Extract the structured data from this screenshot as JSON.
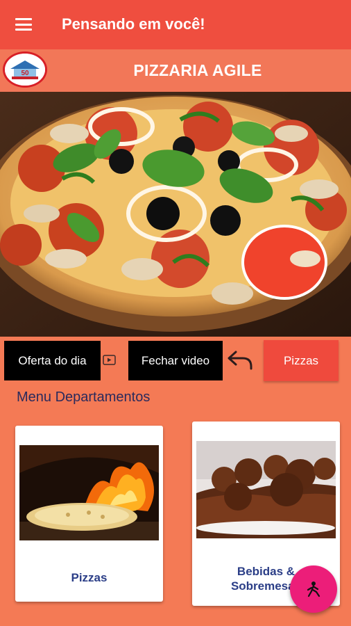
{
  "appbar": {
    "title": "Pensando em você!",
    "menu_icon": "hamburger-menu-icon"
  },
  "brand": {
    "title": "PIZZARIA AGILE",
    "logo_text": "50"
  },
  "video": {
    "subject": "pizza-image"
  },
  "actions": {
    "oferta_label": "Oferta do dia",
    "fechar_label": "Fechar video",
    "pizzas_label": "Pizzas",
    "video_icon": "video-icon",
    "back_icon": "undo-arrow-icon"
  },
  "menu": {
    "title": "Menu Departamentos",
    "departments": [
      {
        "label": "Pizzas"
      },
      {
        "label_line1": "Bebidas &",
        "label_line2": "Sobremesas"
      }
    ]
  },
  "fab": {
    "icon": "person-icon"
  },
  "colors": {
    "appbar": "#ef4e3f",
    "background": "#f47a55",
    "button_primary": "#ef4a3d",
    "fab": "#ec1e79",
    "card_text": "#2b3e87"
  }
}
